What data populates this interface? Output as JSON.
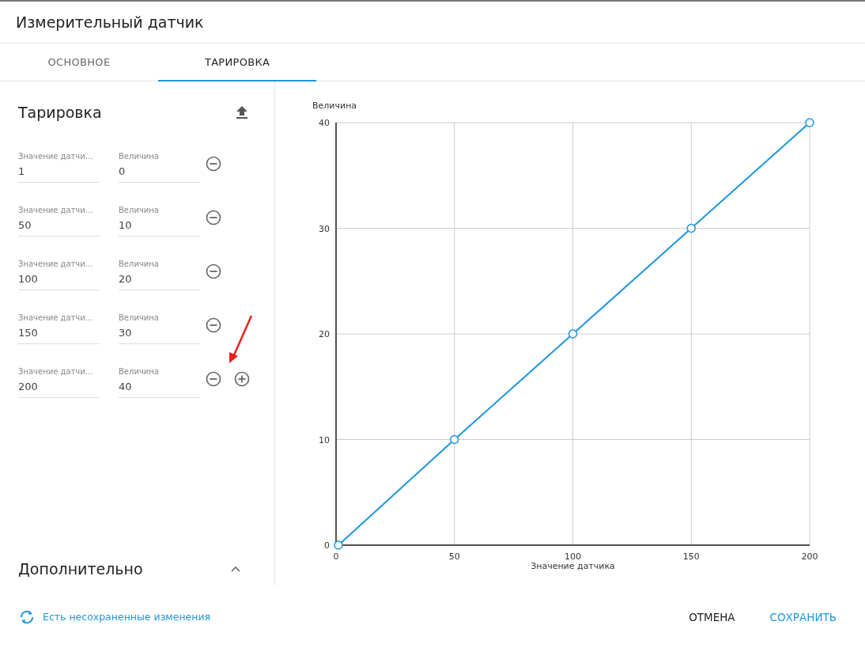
{
  "window": {
    "title": "Измерительный датчик"
  },
  "tabs": [
    {
      "label": "ОСНОВНОЕ",
      "selected": false
    },
    {
      "label": "ТАРИРОВКА",
      "selected": true
    }
  ],
  "calibration": {
    "title": "Тарировка",
    "rows": [
      {
        "sensor_label": "Значение датчи…",
        "sensor_value": "1",
        "value_label": "Величина",
        "value": "0"
      },
      {
        "sensor_label": "Значение датчи…",
        "sensor_value": "50",
        "value_label": "Величина",
        "value": "10"
      },
      {
        "sensor_label": "Значение датчи…",
        "sensor_value": "100",
        "value_label": "Величина",
        "value": "20"
      },
      {
        "sensor_label": "Значение датчи…",
        "sensor_value": "150",
        "value_label": "Величина",
        "value": "30"
      },
      {
        "sensor_label": "Значение датчи…",
        "sensor_value": "200",
        "value_label": "Величина",
        "value": "40"
      }
    ]
  },
  "additional": {
    "title": "Дополнительно"
  },
  "chart": {
    "chart_data": {
      "type": "line",
      "xlabel": "Значение датчика",
      "ylabel": "Величина",
      "x": [
        1,
        50,
        100,
        150,
        200
      ],
      "grid": true,
      "series": [
        {
          "color": "#1e96dc",
          "marker": "circle",
          "values": [
            0,
            10,
            20,
            30,
            40
          ]
        }
      ],
      "xlim": [
        0,
        200
      ],
      "ylim": [
        0,
        40
      ],
      "xticks": [
        0,
        50,
        100,
        150,
        200
      ],
      "yticks": [
        0,
        10,
        20,
        30,
        40
      ]
    }
  },
  "footer": {
    "status": "Есть несохраненные изменения",
    "buttons": [
      {
        "label": "ОТМЕНА",
        "kind": "secondary"
      },
      {
        "label": "СОХРАНИТЬ",
        "kind": "primary"
      }
    ]
  }
}
